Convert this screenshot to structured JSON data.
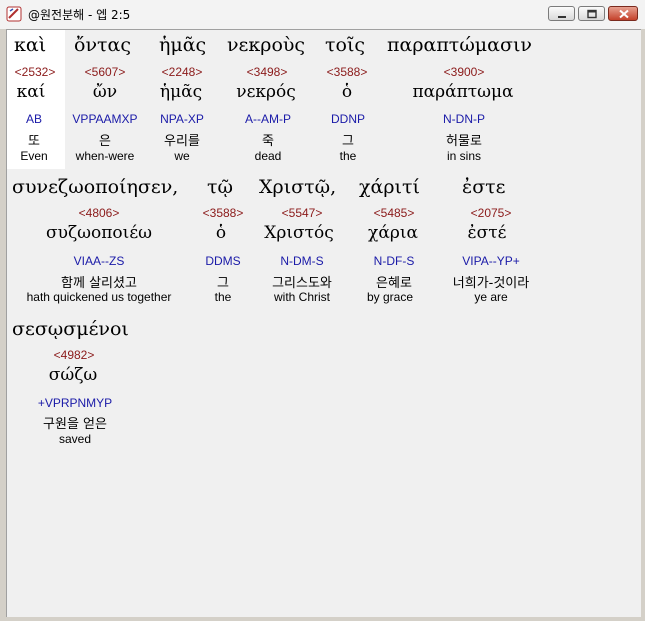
{
  "window": {
    "title": "@원전분해 - 엡 2:5",
    "buttons": {
      "minimize": "minimize",
      "maximize": "maximize",
      "close": "close"
    }
  },
  "colors": {
    "strong_number": "#8b1a1a",
    "morphology": "#1a1aa8",
    "selected_background": "#ffffff",
    "pane_background": "#f0f0f0"
  },
  "verse_line_1": {
    "words": [
      "καὶ",
      "ὄντας",
      "ἡμᾶς",
      "νεκροὺς",
      "τοῖς",
      "παραπτώμασιν"
    ]
  },
  "verse_line_2": {
    "words": [
      "συνεζωοποίησεν,",
      "τῷ",
      "Χριστῷ,",
      "χάριτί",
      "ἐστε"
    ]
  },
  "verse_line_3": {
    "words": [
      "σεσῳσμένοι"
    ]
  },
  "analysis_row_1": [
    {
      "strong": "<2532>",
      "lemma": "καί",
      "morph": "AB",
      "korean": "또",
      "english": "Even"
    },
    {
      "strong": "<5607>",
      "lemma": "ὤν",
      "morph": "VPPAAMXP",
      "korean": "은",
      "english": "when-were"
    },
    {
      "strong": "<2248>",
      "lemma": "ἡμᾶς",
      "morph": "NPA-XP",
      "korean": "우리를",
      "english": "we"
    },
    {
      "strong": "<3498>",
      "lemma": "νεκρός",
      "morph": "A--AM-P",
      "korean": "죽",
      "english": "dead"
    },
    {
      "strong": "<3588>",
      "lemma": "ὁ",
      "morph": "DDNP",
      "korean": "그",
      "english": "the"
    },
    {
      "strong": "<3900>",
      "lemma": "παράπτωμα",
      "morph": "N-DN-P",
      "korean": "허물로",
      "english": "in sins"
    }
  ],
  "analysis_row_2": [
    {
      "strong": "<4806>",
      "lemma": "συζωοποιέω",
      "morph": "VIAA--ZS",
      "korean": "함께 살리셨고",
      "english": "hath quickened us together"
    },
    {
      "strong": "<3588>",
      "lemma": "ὁ",
      "morph": "DDMS",
      "korean": "그",
      "english": "the"
    },
    {
      "strong": "<5547>",
      "lemma": "Χριστός",
      "morph": "N-DM-S",
      "korean": "그리스도와",
      "english": "with Christ"
    },
    {
      "strong": "<5485>",
      "lemma": "χάρια",
      "morph": "N-DF-S",
      "korean": "은혜로",
      "english": "by grace"
    },
    {
      "strong": "<2075>",
      "lemma": "ἐστέ",
      "morph": "VIPA--YP+",
      "korean": "너희가-것이라",
      "english": "ye are"
    }
  ],
  "analysis_row_3": [
    {
      "strong": "<4982>",
      "lemma": "σώζω",
      "morph": "+VPRPNMYP",
      "korean": "구원을 얻은",
      "english": "saved"
    }
  ]
}
